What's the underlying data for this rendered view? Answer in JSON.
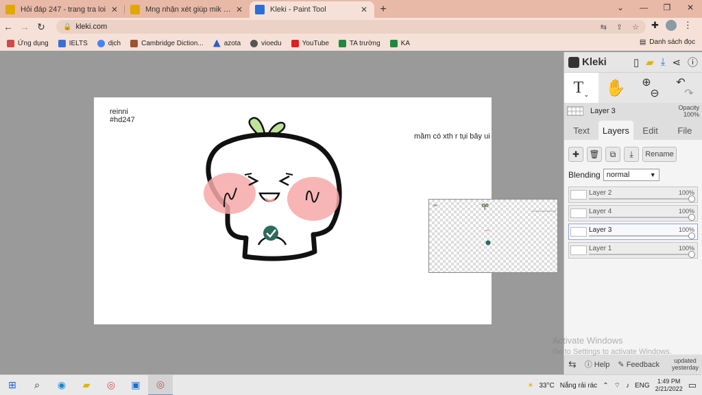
{
  "browser": {
    "tabs": [
      {
        "title": "Hỏi đáp 247 - trang tra loi",
        "color": "#e0a800"
      },
      {
        "title": "Mng nhận xét giúp mik ak :)) Lần",
        "color": "#e0a800"
      },
      {
        "title": "Kleki - Paint Tool",
        "color": "#2b6fd6"
      }
    ],
    "new_tab": "+",
    "url": "kleki.com",
    "bookmarks": [
      {
        "label": "Ứng dụng",
        "color": "#d04a4a"
      },
      {
        "label": "IELTS",
        "color": "#3a6fd8"
      },
      {
        "label": "dịch",
        "color": "#4285f4"
      },
      {
        "label": "Cambridge Diction...",
        "color": "#a0522d"
      },
      {
        "label": "azota",
        "color": "#2a60c8"
      },
      {
        "label": "vioedu",
        "color": "#555555"
      },
      {
        "label": "YouTube",
        "color": "#e02020"
      },
      {
        "label": "TA trường",
        "color": "#1e8a3e"
      },
      {
        "label": "KA",
        "color": "#1e8a3e"
      }
    ],
    "reading_list": "Danh sách đọc"
  },
  "canvas": {
    "text_top_left_1": "reinni",
    "text_top_left_2": "#hd247",
    "text_right": "mầm có xth r tụi bây ui"
  },
  "panel": {
    "logo": "Kleki",
    "current_layer": "Layer 3",
    "opacity_label": "Opacity",
    "opacity_value": "100%",
    "tabs": [
      "Text",
      "Layers",
      "Edit",
      "File"
    ],
    "active_tab": "Layers",
    "rename": "Rename",
    "blending_label": "Blending",
    "blending_value": "normal",
    "layers": [
      {
        "name": "Layer 2",
        "opacity": "100%",
        "selected": false
      },
      {
        "name": "Layer 4",
        "opacity": "100%",
        "selected": false
      },
      {
        "name": "Layer 3",
        "opacity": "100%",
        "selected": true
      },
      {
        "name": "Layer 1",
        "opacity": "100%",
        "selected": false
      }
    ],
    "help": "Help",
    "feedback": "Feedback",
    "updated_1": "updated",
    "updated_2": "yesterday"
  },
  "watermark": {
    "line1": "Activate Windows",
    "line2": "Go to Settings to activate Windows."
  },
  "taskbar": {
    "weather": "33°C",
    "weather_desc": "Nắng rải rác",
    "lang": "ENG",
    "time": "1:49 PM",
    "date": "2/21/2022"
  }
}
